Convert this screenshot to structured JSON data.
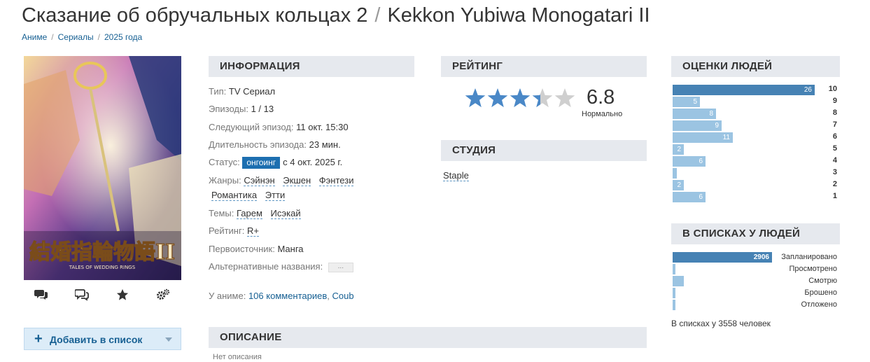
{
  "title": {
    "ru": "Сказание об обручальных кольцах 2",
    "separator": "/",
    "romaji": "Kekkon Yubiwa Monogatari II"
  },
  "breadcrumb": [
    "Аниме",
    "Сериалы",
    "2025 года"
  ],
  "breadcrumb_sep": "/",
  "poster": {
    "logo_text": "結婚指輪物語II",
    "logo_sub": "TALES OF WEDDING RINGS"
  },
  "actions": [
    "comments-icon",
    "discussion-icon",
    "favorite-star-icon",
    "settings-gears-icon"
  ],
  "add_button": {
    "plus": "+",
    "label": "Добавить в список"
  },
  "info": {
    "heading": "ИНФОРМАЦИЯ",
    "type_k": "Тип:",
    "type_v": "TV Сериал",
    "episodes_k": "Эпизоды:",
    "episodes_v": "1 / 13",
    "next_k": "Следующий эпизод:",
    "next_v": "11 окт. 15:30",
    "duration_k": "Длительность эпизода:",
    "duration_v": "23 мин.",
    "status_k": "Статус:",
    "status_badge": "онгоинг",
    "status_v": "с 4 окт. 2025 г.",
    "genres_k": "Жанры:",
    "genres": [
      "Сэйнэн",
      "Экшен",
      "Фэнтези",
      "Романтика",
      "Этти"
    ],
    "themes_k": "Темы:",
    "themes": [
      "Гарем",
      "Исэкай"
    ],
    "rating_k": "Рейтинг:",
    "rating_v": "R+",
    "source_k": "Первоисточник:",
    "source_v": "Манга",
    "alt_k": "Альтернативные названия:",
    "alt_dots": "...",
    "about_k": "У аниме:",
    "comments": "106 комментариев",
    "comma": ",",
    "coub": "Coub"
  },
  "rating": {
    "heading": "РЕЙТИНГ",
    "score": "6.8",
    "stars_fraction": 0.68,
    "label": "Нормально"
  },
  "studio": {
    "heading": "СТУДИЯ",
    "name": "Staple"
  },
  "description": {
    "heading": "ОПИСАНИЕ",
    "text": "Нет описания"
  },
  "scores": {
    "heading": "ОЦЕНКИ ЛЮДЕЙ",
    "rows": [
      {
        "score": "10",
        "count": "26",
        "value": 26
      },
      {
        "score": "9",
        "count": "5",
        "value": 5
      },
      {
        "score": "8",
        "count": "8",
        "value": 8
      },
      {
        "score": "7",
        "count": "9",
        "value": 9
      },
      {
        "score": "6",
        "count": "11",
        "value": 11
      },
      {
        "score": "5",
        "count": "2",
        "value": 2
      },
      {
        "score": "4",
        "count": "6",
        "value": 6
      },
      {
        "score": "3",
        "count": "",
        "value": 0.5
      },
      {
        "score": "2",
        "count": "2",
        "value": 2
      },
      {
        "score": "1",
        "count": "6",
        "value": 6
      }
    ]
  },
  "lists": {
    "heading": "В СПИСКАХ У ЛЮДЕЙ",
    "rows": [
      {
        "label": "Запланировано",
        "count": "2906",
        "value": 2906
      },
      {
        "label": "Просмотрено",
        "count": "",
        "value": 3
      },
      {
        "label": "Смотрю",
        "count": "",
        "value": 330
      },
      {
        "label": "Брошено",
        "count": "",
        "value": 70
      },
      {
        "label": "Отложено",
        "count": "",
        "value": 70
      }
    ],
    "total": "В списках у 3558 человек"
  },
  "colors": {
    "link": "#176093",
    "bar": "#9bc4e2",
    "bar_top": "#4682b4",
    "star": "#4a88c7",
    "badge": "#1d6fb0",
    "head_bg": "#e6e9ee"
  }
}
